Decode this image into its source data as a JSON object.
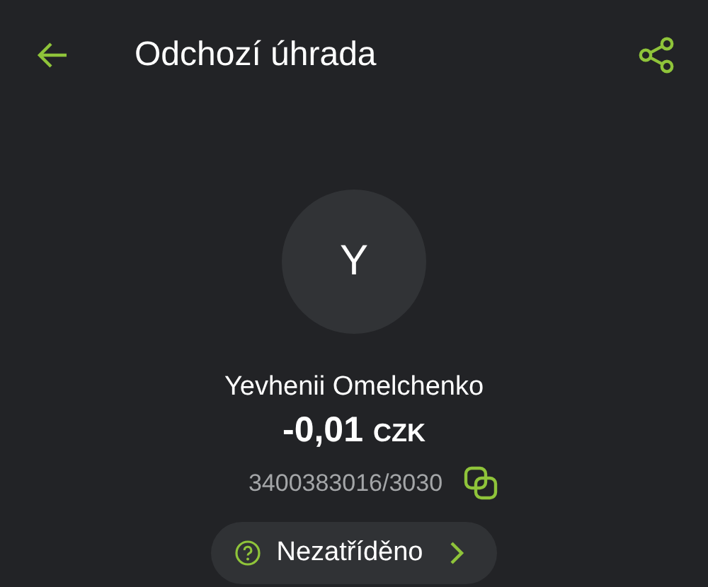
{
  "header": {
    "title": "Odchozí úhrada"
  },
  "counterparty": {
    "initial": "Y",
    "name": "Yevhenii Omelchenko",
    "amount": "-0,01",
    "currency": "CZK",
    "account": "3400383016/3030"
  },
  "category": {
    "label": "Nezatříděno"
  }
}
